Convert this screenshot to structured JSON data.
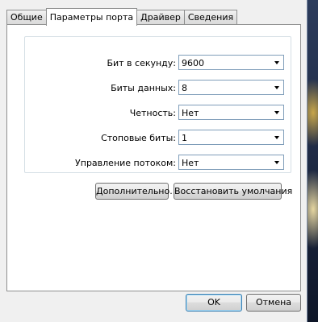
{
  "tabs": [
    {
      "label": "Общие"
    },
    {
      "label": "Параметры порта"
    },
    {
      "label": "Драйвер"
    },
    {
      "label": "Сведения"
    }
  ],
  "settings": {
    "baud": {
      "label": "Бит в секунду:",
      "value": "9600"
    },
    "data_bits": {
      "label": "Биты данных:",
      "value": "8"
    },
    "parity": {
      "label": "Четность:",
      "value": "Нет"
    },
    "stop_bits": {
      "label": "Стоповые биты:",
      "value": "1"
    },
    "flow_control": {
      "label": "Управление потоком:",
      "value": "Нет"
    }
  },
  "buttons": {
    "advanced": "Дополнительно...",
    "restore_defaults": "Восстановить умолчания",
    "ok": "OK",
    "cancel": "Отмена"
  }
}
